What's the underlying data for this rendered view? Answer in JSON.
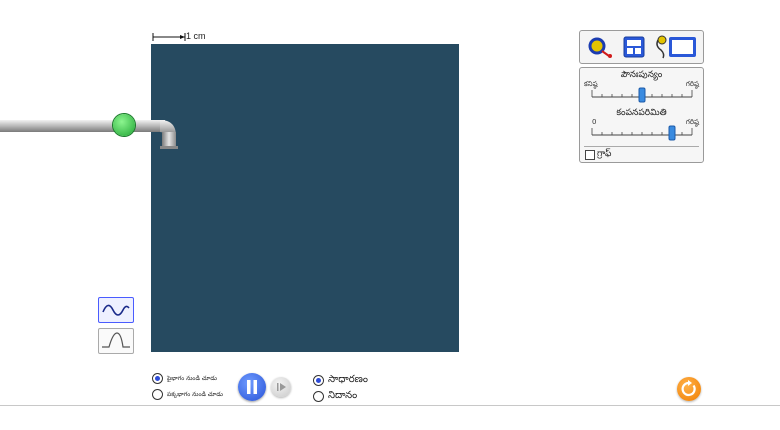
{
  "scale": {
    "label": "1 cm"
  },
  "controls": {
    "frequency": {
      "label": "పౌనఃపున్యం",
      "min_label": "కనిష్ఠ",
      "max_label": "గరిష్ఠ",
      "value": 0.5
    },
    "amplitude": {
      "label": "కంపనపరిమితి",
      "min_label": "0",
      "max_label": "గరిష్ఠ",
      "value": 0.8
    },
    "graph_label": "గ్రాఫ్",
    "graph_checked": false
  },
  "view": {
    "option1": "పైభాగం నుండి చూడు",
    "option2": "పక్కభాగం నుండి చూడు",
    "selected": 0
  },
  "speed": {
    "normal": "సాధారణం",
    "slow": "నిదానం",
    "selected": 0
  },
  "colors": {
    "water": "#264a60",
    "accent": "#2d4bd8",
    "reset": "#f07d00",
    "valve": "#33c24a"
  },
  "icons": [
    "magnifier-icon",
    "stopwatch-icon",
    "probe-icon",
    "wave-continuous-icon",
    "wave-pulse-icon",
    "pause-icon",
    "step-icon",
    "reset-icon"
  ]
}
